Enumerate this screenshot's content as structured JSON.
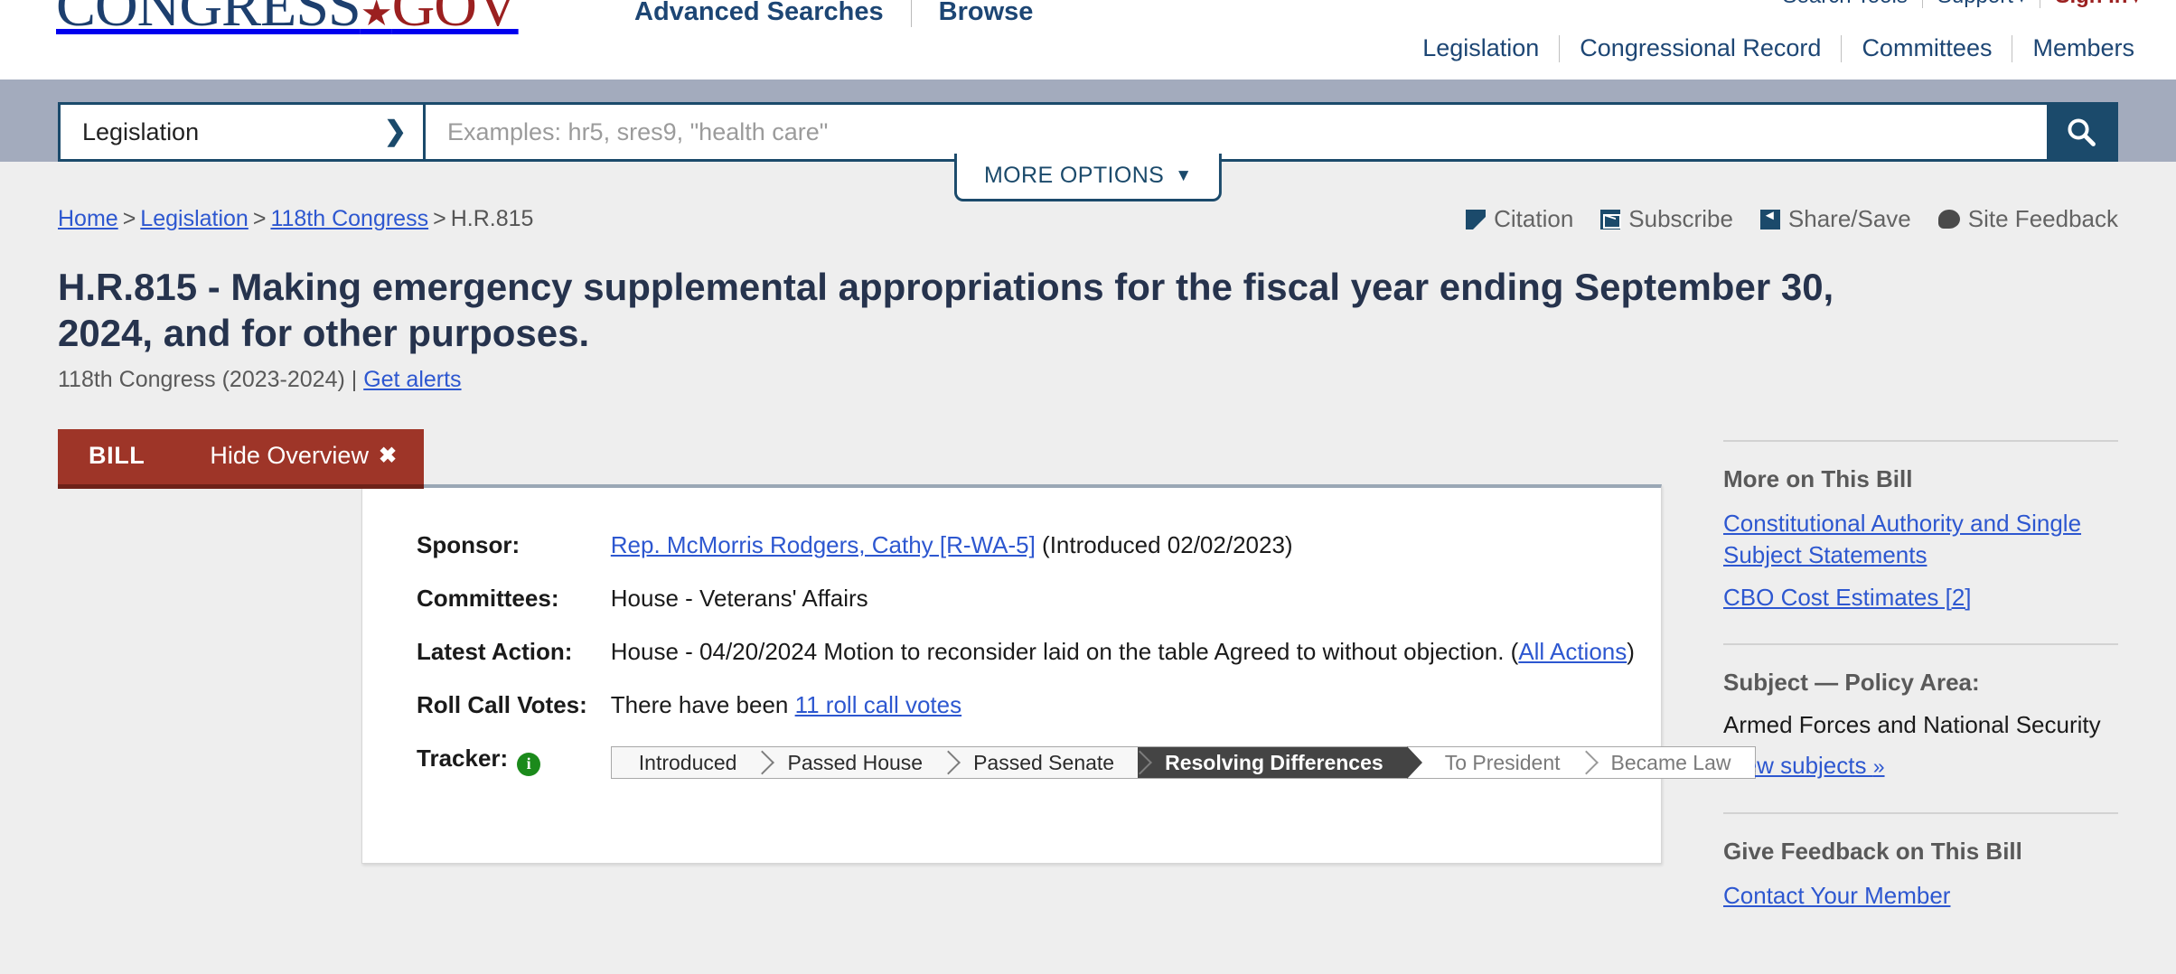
{
  "header": {
    "logo": {
      "part1": "CONGRESS",
      "star": "★",
      "part2": "GOV"
    },
    "top_links": [
      {
        "label": "Advanced Searches"
      },
      {
        "label": "Browse"
      }
    ],
    "utility_links": [
      {
        "label": "Search Tools",
        "caret": ""
      },
      {
        "label": "Support",
        "caret": "▾"
      },
      {
        "label": "Sign In",
        "caret": "▾"
      }
    ],
    "main_nav": [
      {
        "label": "Legislation"
      },
      {
        "label": "Congressional Record"
      },
      {
        "label": "Committees"
      },
      {
        "label": "Members"
      }
    ]
  },
  "search": {
    "selected_scope": "Legislation",
    "placeholder": "Examples: hr5, sres9, \"health care\"",
    "value": "",
    "more_options_label": "MORE OPTIONS",
    "more_options_caret": "⌄",
    "search_icon": "search-icon"
  },
  "breadcrumb": {
    "items": [
      {
        "label": "Home",
        "link": true
      },
      {
        "label": "Legislation",
        "link": true
      },
      {
        "label": "118th Congress",
        "link": true
      },
      {
        "label": "H.R.815",
        "link": false
      }
    ],
    "separator": ">"
  },
  "page_tools": [
    {
      "label": "Citation",
      "icon": "citation-icon"
    },
    {
      "label": "Subscribe",
      "icon": "envelope-icon"
    },
    {
      "label": "Share/Save",
      "icon": "share-icon"
    },
    {
      "label": "Site Feedback",
      "icon": "speech-bubble-icon"
    }
  ],
  "bill": {
    "title": "H.R.815 - Making emergency supplemental appropriations for the fiscal year ending September 30, 2024, and for other purposes.",
    "congress_line": "118th Congress (2023-2024) | ",
    "get_alerts_label": "Get alerts"
  },
  "overview": {
    "tab_label": "BILL",
    "hide_label": "Hide Overview",
    "hide_icon": "✖",
    "rows": {
      "sponsor_label": "Sponsor:",
      "sponsor_link": "Rep. McMorris Rodgers, Cathy [R-WA-5]",
      "sponsor_suffix": " (Introduced 02/02/2023)",
      "committees_label": "Committees:",
      "committees_value": "House - Veterans' Affairs",
      "latest_action_label": "Latest Action:",
      "latest_action_value": "House - 04/20/2024 Motion to reconsider laid on the table Agreed to without objection.  (",
      "all_actions_link": "All Actions",
      "latest_action_close": ")",
      "roll_call_label": "Roll Call Votes:",
      "roll_call_prefix": "There have been ",
      "roll_call_link": "11 roll call votes",
      "tracker_label": "Tracker:",
      "tracker_info_icon": "i"
    },
    "tracker_steps": [
      {
        "label": "Introduced",
        "state": "done"
      },
      {
        "label": "Passed House",
        "state": "done"
      },
      {
        "label": "Passed Senate",
        "state": "done"
      },
      {
        "label": "Resolving Differences",
        "state": "current"
      },
      {
        "label": "To President",
        "state": "future"
      },
      {
        "label": "Became Law",
        "state": "future"
      }
    ]
  },
  "sidebar": {
    "sections": [
      {
        "heading": "More on This Bill",
        "links": [
          "Constitutional Authority and Single Subject Statements",
          "CBO Cost Estimates [2]"
        ]
      },
      {
        "heading": "Subject — Policy Area:",
        "text": "Armed Forces and National Security",
        "links": [
          "View subjects"
        ],
        "link_suffix": "»"
      },
      {
        "heading": "Give Feedback on This Bill",
        "links": [
          "Contact Your Member"
        ]
      }
    ]
  },
  "colors": {
    "brand_blue": "#1d3f6e",
    "brand_red": "#9b2020",
    "search_band": "#a3abbd",
    "search_border": "#1b4a6b",
    "bill_tab_red": "#9e3528",
    "link_blue": "#2d57d0",
    "tracker_current": "#444444",
    "info_green": "#1b8a1b"
  }
}
